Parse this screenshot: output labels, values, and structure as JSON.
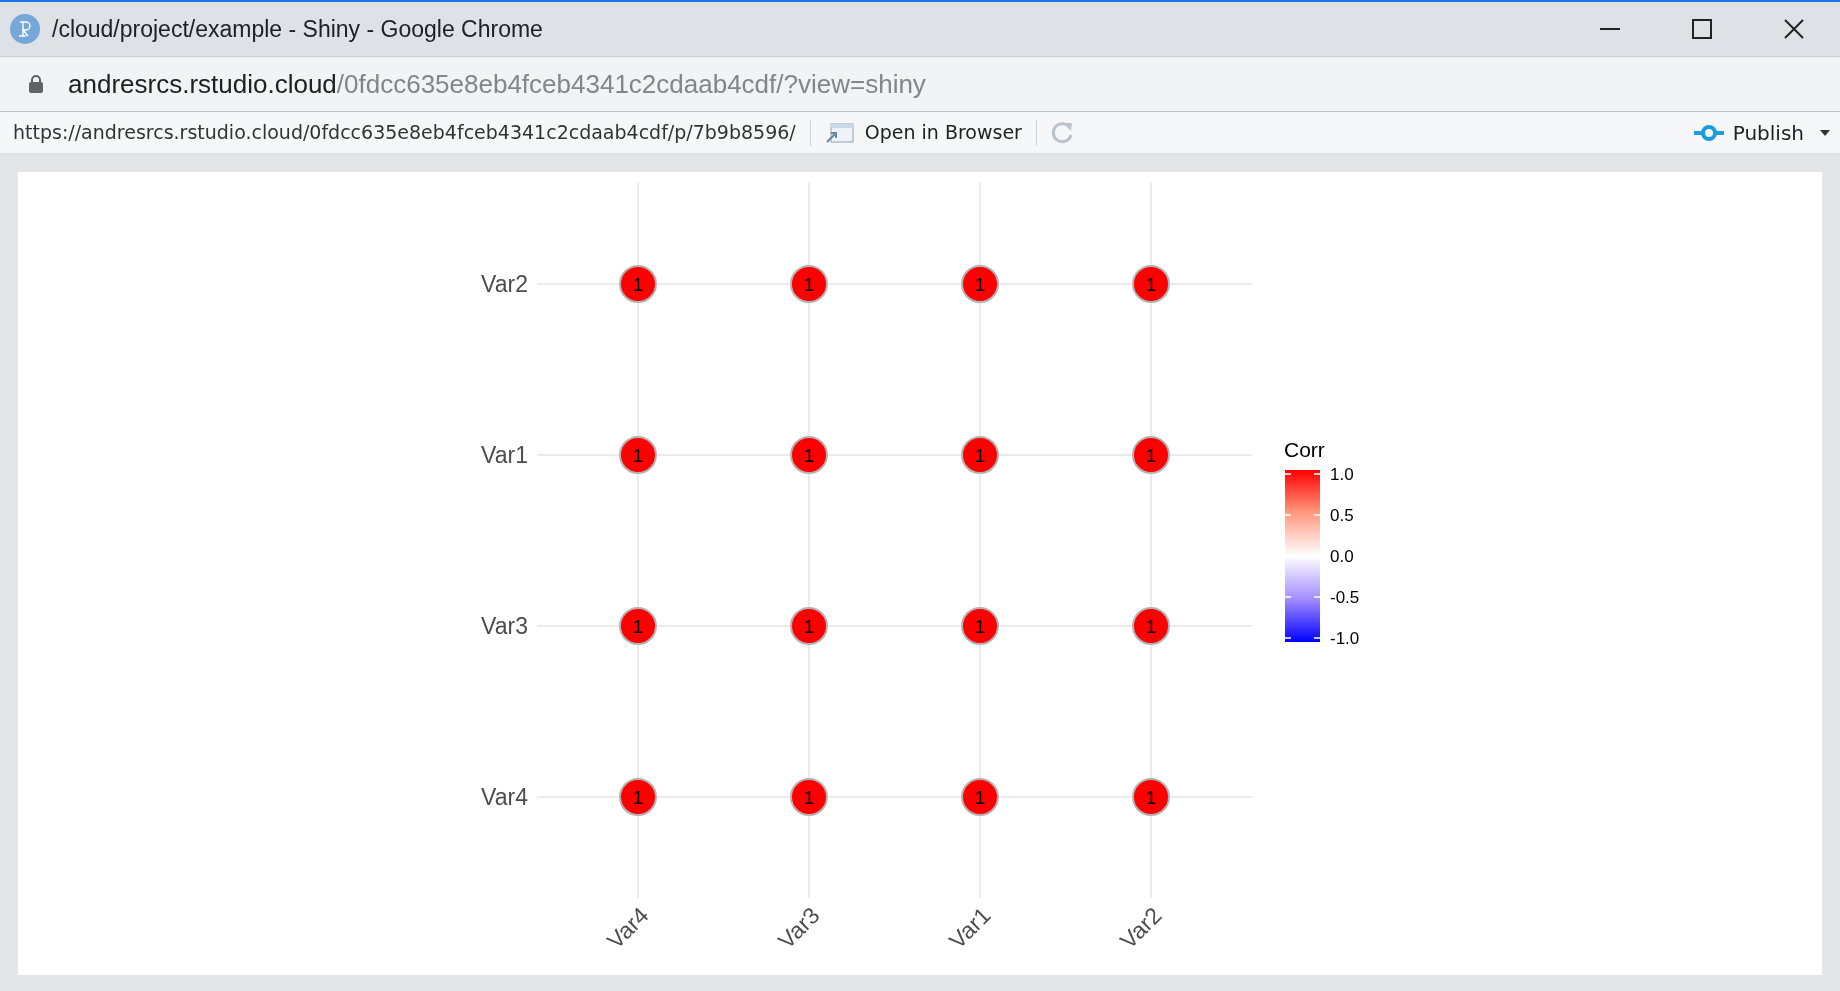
{
  "window": {
    "title": "/cloud/project/example - Shiny - Google Chrome"
  },
  "address_bar": {
    "host": "andresrcs.rstudio.cloud",
    "path": "/0fdcc635e8eb4fceb4341c2cdaab4cdf/?view=shiny"
  },
  "toolbar": {
    "url": "https://andresrcs.rstudio.cloud/0fdcc635e8eb4fceb4341c2cdaab4cdf/p/7b9b8596/",
    "open_button": "Open in Browser",
    "publish_button": "Publish"
  },
  "plot": {
    "column_labels": [
      "Var4",
      "Var3",
      "Var1",
      "Var2"
    ],
    "rows": [
      {
        "label": "Var2",
        "cells": [
          "1",
          "1",
          "1",
          "1"
        ]
      },
      {
        "label": "Var1",
        "cells": [
          "1",
          "1",
          "1",
          "1"
        ]
      },
      {
        "label": "Var3",
        "cells": [
          "1",
          "1",
          "1",
          "1"
        ]
      },
      {
        "label": "Var4",
        "cells": [
          "1",
          "1",
          "1",
          "1"
        ]
      }
    ],
    "legend": {
      "title": "Corr",
      "ticks": [
        "1.0",
        "0.5",
        "0.0",
        "-0.5",
        "-1.0"
      ]
    }
  }
}
